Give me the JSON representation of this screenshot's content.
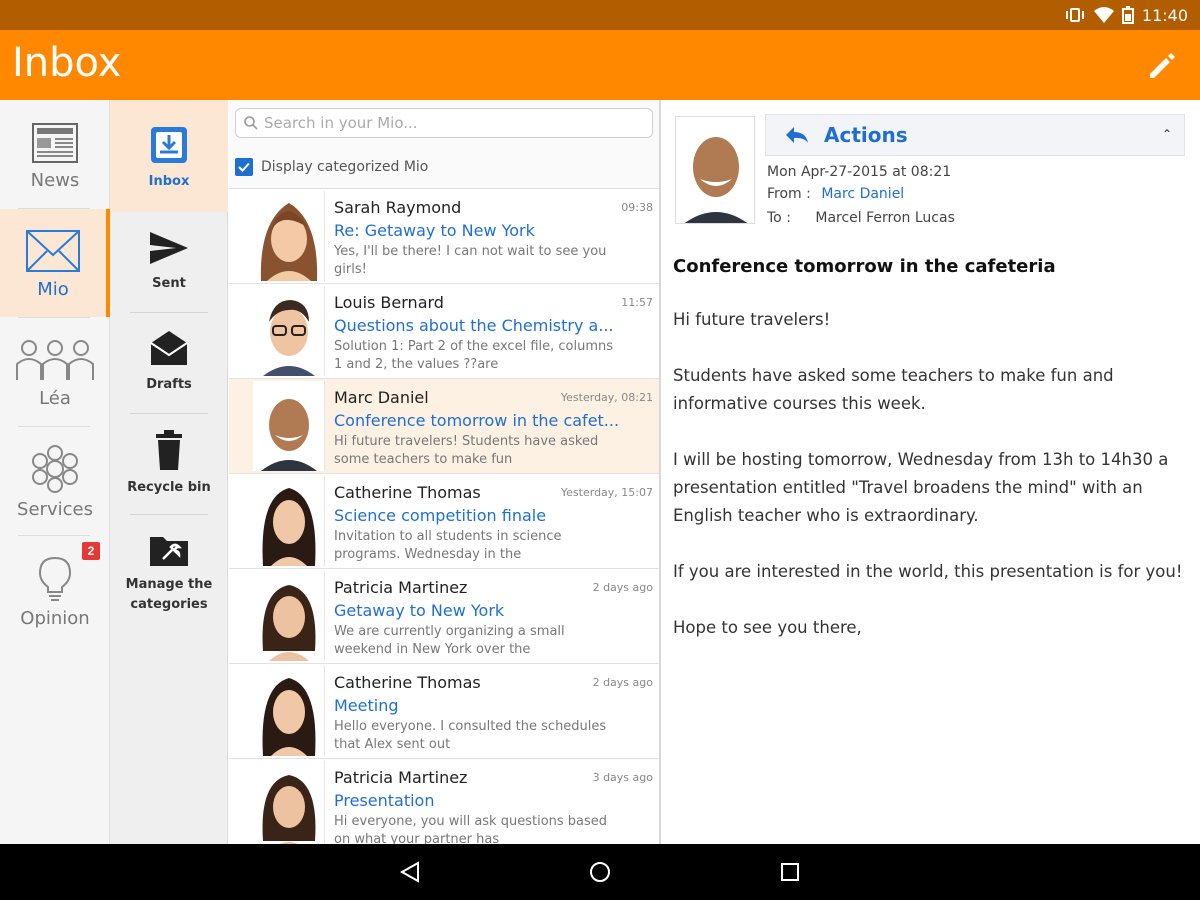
{
  "status": {
    "time": "11:40"
  },
  "header": {
    "title": "Inbox"
  },
  "nav_primary": [
    {
      "label": "News"
    },
    {
      "label": "Mio"
    },
    {
      "label": "Léa"
    },
    {
      "label": "Services",
      "badge": "2"
    },
    {
      "label": "Opinion"
    }
  ],
  "nav_secondary": [
    {
      "label": "Inbox"
    },
    {
      "label": "Sent"
    },
    {
      "label": "Drafts"
    },
    {
      "label": "Recycle bin"
    },
    {
      "label": "Manage the categories"
    }
  ],
  "search": {
    "placeholder": "Search in your Mio..."
  },
  "category_toggle": {
    "label": "Display categorized Mio"
  },
  "messages": [
    {
      "sender": "Sarah Raymond",
      "time": "09:38",
      "subject": "Re: Getaway to New York",
      "preview": "Yes, I'll be there! I can not wait to see you girls!"
    },
    {
      "sender": "Louis Bernard",
      "time": "11:57",
      "subject": "Questions about the Chemistry a...",
      "preview": "Solution 1: Part 2 of the excel file, columns 1 and 2, the values ??are"
    },
    {
      "sender": "Marc Daniel",
      "time": "Yesterday, 08:21",
      "subject": "Conference tomorrow in the cafet...",
      "preview": "Hi future travelers! Students have asked some teachers to make fun"
    },
    {
      "sender": "Catherine Thomas",
      "time": "Yesterday, 15:07",
      "subject": "Science competition finale",
      "preview": "Invitation to all students in science programs. Wednesday in the"
    },
    {
      "sender": "Patricia Martinez",
      "time": "2 days ago",
      "subject": "Getaway to New York",
      "preview": "We are currently organizing a small weekend in New York over the"
    },
    {
      "sender": "Catherine Thomas",
      "time": "2 days ago",
      "subject": "Meeting",
      "preview": "Hello everyone. I consulted the schedules that Alex sent out"
    },
    {
      "sender": "Patricia Martinez",
      "time": "3 days ago",
      "subject": "Presentation",
      "preview": "Hi everyone, you will ask questions based on what your partner has"
    }
  ],
  "reader": {
    "actions_label": "Actions",
    "date": "Mon Apr-27-2015 at 08:21",
    "from_label": "From :",
    "from_name": "Marc Daniel",
    "to_label": "To :",
    "to_name": "Marcel Ferron Lucas",
    "subject": "Conference tomorrow in the cafeteria",
    "body": [
      "Hi future travelers!",
      "Students have asked some teachers to make fun and informative courses this week.",
      "I will be hosting tomorrow, Wednesday from 13h to 14h30 a presentation entitled \"Travel broadens the mind\" with an English teacher who is extraordinary.",
      "If you are interested in the world, this presentation is for you!",
      "Hope to see you there,"
    ]
  },
  "colors": {
    "accent": "#ff8800",
    "statusbar": "#b25e00",
    "link": "#1f6fd1",
    "selected": "#fbe7d3",
    "badge": "#e53935"
  }
}
